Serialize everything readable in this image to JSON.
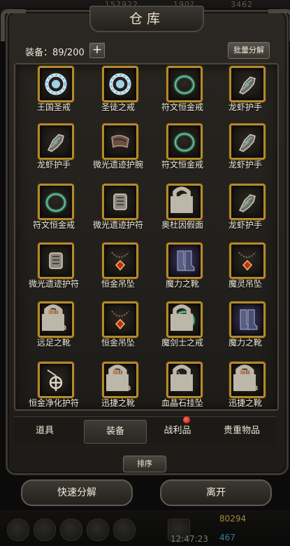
{
  "header": {
    "title": "仓库",
    "bg_numbers": [
      "157922",
      "190?",
      "3462"
    ]
  },
  "toolbar": {
    "equip_count": "装备：89/200",
    "add_label": "+",
    "batch_label": "批量分解"
  },
  "items": [
    {
      "name": "王国圣戒",
      "icon": "crystal-ring-icon",
      "locked": false,
      "bg": "dark"
    },
    {
      "name": "圣徒之戒",
      "icon": "crystal-ring-icon",
      "locked": false,
      "bg": "dark"
    },
    {
      "name": "符文恒金戒",
      "icon": "green-ring-icon",
      "locked": false,
      "bg": "dark"
    },
    {
      "name": "龙虾护手",
      "icon": "gauntlet-icon",
      "locked": false,
      "bg": "dark"
    },
    {
      "name": "龙虾护手",
      "icon": "gauntlet-icon",
      "locked": false,
      "bg": "dark"
    },
    {
      "name": "微光遗迹护腕",
      "icon": "bracer-icon",
      "locked": false,
      "bg": "dark"
    },
    {
      "name": "符文恒金戒",
      "icon": "green-ring-icon",
      "locked": false,
      "bg": "dark"
    },
    {
      "name": "龙虾护手",
      "icon": "gauntlet-icon",
      "locked": false,
      "bg": "dark"
    },
    {
      "name": "符文恒金戒",
      "icon": "green-ring-icon",
      "locked": false,
      "bg": "dark"
    },
    {
      "name": "微光遗迹护符",
      "icon": "amulet-icon",
      "locked": false,
      "bg": "dark"
    },
    {
      "name": "奥杜因假面",
      "icon": "skull-mask-icon",
      "locked": true,
      "bg": "dark"
    },
    {
      "name": "龙虾护手",
      "icon": "gauntlet-icon",
      "locked": false,
      "bg": "dark"
    },
    {
      "name": "微光遗迹护符",
      "icon": "amulet-icon",
      "locked": false,
      "bg": "dark"
    },
    {
      "name": "恒金吊坠",
      "icon": "pendant-icon",
      "locked": false,
      "bg": "dark"
    },
    {
      "name": "魔力之靴",
      "icon": "purple-boots-icon",
      "locked": false,
      "bg": "purple"
    },
    {
      "name": "魔灵吊坠",
      "icon": "pendant-icon",
      "locked": false,
      "bg": "dark"
    },
    {
      "name": "远足之靴",
      "icon": "leather-boots-icon",
      "locked": true,
      "bg": "dark"
    },
    {
      "name": "恒金吊坠",
      "icon": "pendant-icon",
      "locked": false,
      "bg": "dark"
    },
    {
      "name": "魔剑士之戒",
      "icon": "green-ring-icon",
      "locked": true,
      "bg": "dark"
    },
    {
      "name": "魔力之靴",
      "icon": "purple-boots-icon",
      "locked": false,
      "bg": "purple"
    },
    {
      "name": "恒金净化护符",
      "icon": "cross-amulet-icon",
      "locked": false,
      "bg": "dark"
    },
    {
      "name": "迅捷之靴",
      "icon": "leather-boots-icon",
      "locked": true,
      "bg": "dark"
    },
    {
      "name": "血晶石挂坠",
      "icon": "blood-crystal-icon",
      "locked": true,
      "bg": "dark"
    },
    {
      "name": "迅捷之靴",
      "icon": "leather-boots-icon",
      "locked": true,
      "bg": "dark"
    }
  ],
  "tabs": [
    {
      "label": "道具",
      "active": false
    },
    {
      "label": "装备",
      "active": true
    },
    {
      "label": "战利品",
      "active": false,
      "badge": true
    },
    {
      "label": "贵重物品",
      "active": false
    }
  ],
  "sort_label": "排序",
  "actions": {
    "quick_decompose": "快速分解",
    "leave": "离开"
  },
  "status": {
    "time": "12:47:23",
    "gold": "80294",
    "gems": "467"
  },
  "colors": {
    "slot_border": "#b38a2a",
    "badge": "#d9231a"
  }
}
